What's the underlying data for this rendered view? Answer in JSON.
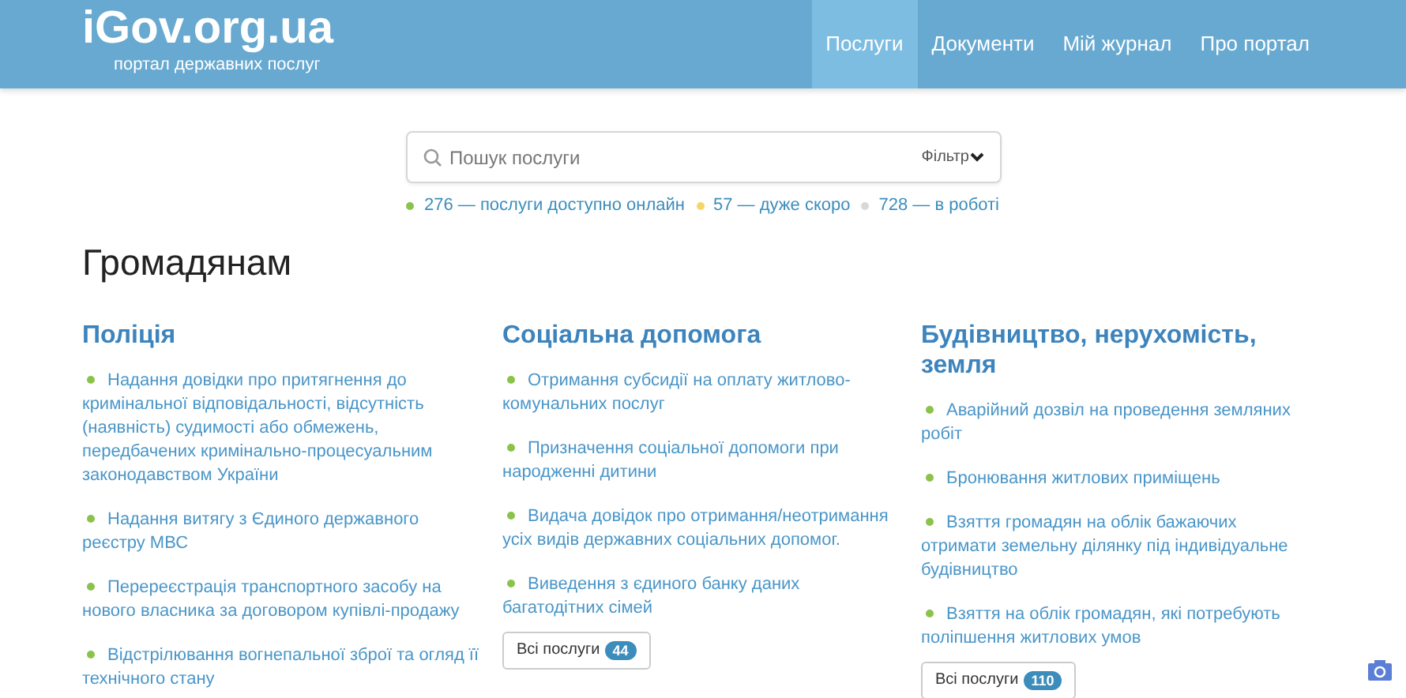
{
  "header": {
    "logo": "iGov.org.ua",
    "tagline": "портал державних послуг",
    "nav": [
      {
        "label": "Послуги",
        "selected": true
      },
      {
        "label": "Документи",
        "selected": false
      },
      {
        "label": "Мій журнал",
        "selected": false
      },
      {
        "label": "Про портал",
        "selected": false
      }
    ]
  },
  "search": {
    "placeholder": "Пошук послуги",
    "filter": "Фільтр"
  },
  "stats": [
    {
      "color": "#8bc34a",
      "text": "276 — послуги доступно онлайн"
    },
    {
      "color": "#f5d56a",
      "text": "57 — дуже скоро"
    },
    {
      "color": "#d8d8d8",
      "text": "728 — в роботі"
    }
  ],
  "heading": "Громадянам",
  "categories": [
    {
      "title": "Поліція",
      "items": [
        "Надання довідки про притягнення до кримінальної відповідальності, відсутність (наявність) судимості або обмежень, передбачених кримінально-процесуальним законодавством України",
        "Надання витягу з Єдиного державного реєстру МВС",
        "Перереєстрація транспортного засобу на нового власника за договором купівлі-продажу",
        "Відстрілювання вогнепальної зброї та огляд її технічного стану"
      ]
    },
    {
      "title": "Соціальна допомога",
      "items": [
        "Отримання субсидії на оплату житлово-комунальних послуг",
        "Призначення соціальної допомоги при народженні дитини",
        "Видача довідок про отримання/неотримання усіх видів державних соціальних допомог.",
        "Виведення з єдиного банку даних багатодітних сімей"
      ],
      "all_button": {
        "label": "Всі послуги",
        "count": "44"
      }
    },
    {
      "title": "Будівництво, нерухомість, земля",
      "items": [
        "Аварійний дозвіл на проведення земляних робіт",
        "Бронювання житлових приміщень",
        "Взяття громадян на облік бажаючих отримати земельну ділянку під індивідуальне будівництво",
        "Взяття на облік громадян, які потребують поліпшення житлових умов"
      ],
      "all_button": {
        "label": "Всі послуги",
        "count": "110"
      }
    }
  ]
}
